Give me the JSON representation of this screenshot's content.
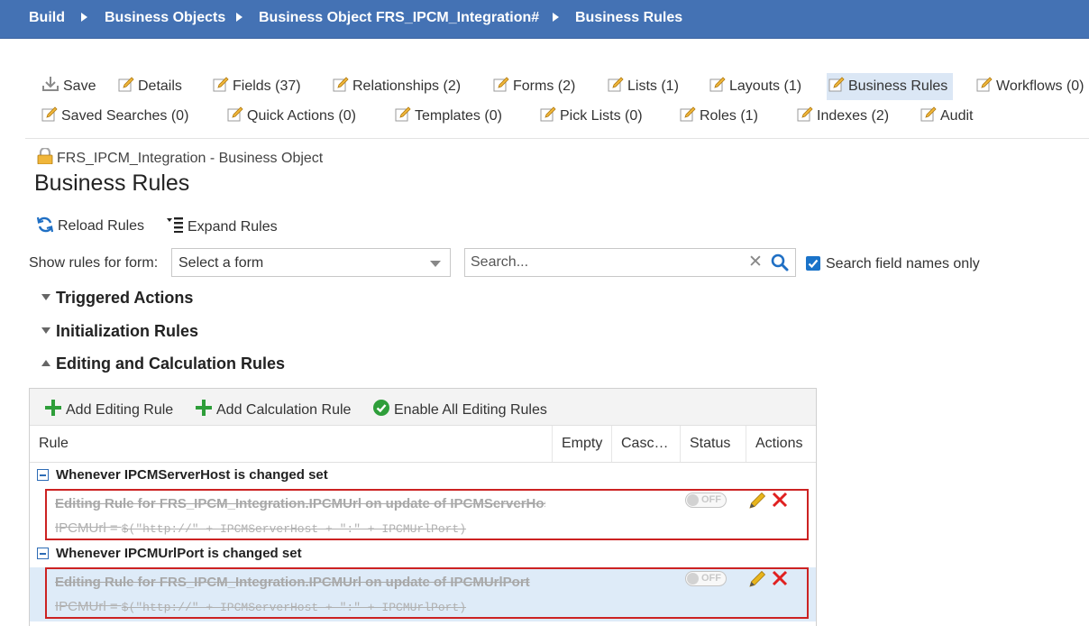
{
  "breadcrumb": [
    "Build",
    "Business Objects",
    "Business Object FRS_IPCM_Integration#",
    "Business Rules"
  ],
  "toolbar": {
    "save": "Save",
    "tabs_row1": [
      "Details",
      "Fields (37)",
      "Relationships (2)",
      "Forms (2)",
      "Lists (1)",
      "Layouts (1)",
      "Business Rules",
      "Workflows (0)"
    ],
    "tabs_row2": [
      "Saved Searches (0)",
      "Quick Actions (0)",
      "Templates (0)",
      "Pick Lists (0)",
      "Roles (1)",
      "Indexes (2)",
      "Audit"
    ],
    "active_tab": "Business Rules"
  },
  "page": {
    "object_line": "FRS_IPCM_Integration - Business Object",
    "title": "Business Rules"
  },
  "actions": {
    "reload": "Reload Rules",
    "expand": "Expand Rules"
  },
  "filter": {
    "form_label": "Show rules for form:",
    "form_select": "Select a form",
    "search_placeholder": "Search...",
    "search_field_names_only": "Search field names only",
    "search_field_names_checked": true
  },
  "sections": {
    "triggered": "Triggered Actions",
    "initialization": "Initialization Rules",
    "editing": "Editing and Calculation Rules"
  },
  "editing_panel": {
    "add_editing": "Add Editing Rule",
    "add_calculation": "Add Calculation Rule",
    "enable_all": "Enable All Editing Rules",
    "columns": [
      "Rule",
      "Empty",
      "Casc…",
      "Status",
      "Actions"
    ],
    "groups": [
      {
        "header": "Whenever IPCMServerHost is changed set",
        "rule_title": "Editing Rule for FRS_IPCM_Integration.IPCMUrl on update of IPCMServerHost",
        "rule_lhs": "IPCMUrl = ",
        "rule_expr": "$(\"http://\" + IPCMServerHost + \":\" + IPCMUrlPort)",
        "status": "OFF",
        "selected": false
      },
      {
        "header": "Whenever IPCMUrlPort is changed set",
        "rule_title": "Editing Rule for FRS_IPCM_Integration.IPCMUrl on update of IPCMUrlPort",
        "rule_lhs": "IPCMUrl = ",
        "rule_expr": "$(\"http://\" + IPCMServerHost + \":\" + IPCMUrlPort)",
        "status": "OFF",
        "selected": true
      }
    ]
  },
  "colors": {
    "header_bg": "#4472b4",
    "active_tab_bg": "#dbe7f5",
    "highlight_box": "#cc2222",
    "add_green": "#2e9e3a",
    "delete_red": "#e02020",
    "edit_yellow": "#e8b51c"
  }
}
